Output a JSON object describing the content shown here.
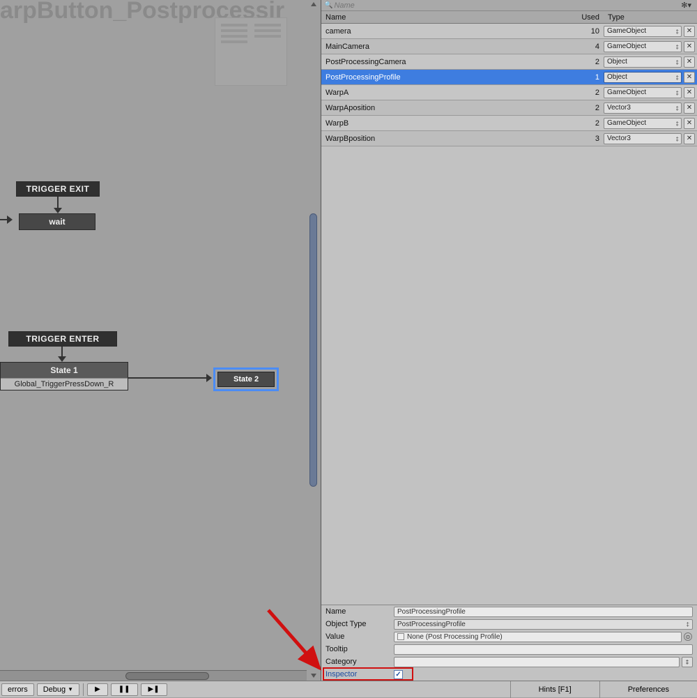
{
  "graph": {
    "title": "arpButton_Postprocessir",
    "trigger_exit": "TRIGGER EXIT",
    "wait": "wait",
    "trigger_enter": "TRIGGER ENTER",
    "state1": "State 1",
    "state1_sub": "Global_TriggerPressDown_R",
    "state2": "State 2"
  },
  "search": {
    "placeholder": "Name"
  },
  "columns": {
    "name": "Name",
    "used": "Used",
    "type": "Type"
  },
  "vars": [
    {
      "name": "camera",
      "used": 10,
      "type": "GameObject"
    },
    {
      "name": "MainCamera",
      "used": 4,
      "type": "GameObject"
    },
    {
      "name": "PostProcessingCamera",
      "used": 2,
      "type": "Object"
    },
    {
      "name": "PostProcessingProfile",
      "used": 1,
      "type": "Object",
      "selected": true
    },
    {
      "name": "WarpA",
      "used": 2,
      "type": "GameObject"
    },
    {
      "name": "WarpAposition",
      "used": 2,
      "type": "Vector3"
    },
    {
      "name": "WarpB",
      "used": 2,
      "type": "GameObject"
    },
    {
      "name": "WarpBposition",
      "used": 3,
      "type": "Vector3"
    }
  ],
  "details": {
    "name_label": "Name",
    "name_value": "PostProcessingProfile",
    "obj_type_label": "Object Type",
    "obj_type_value": "PostProcessingProfile",
    "value_label": "Value",
    "value_value": "None (Post Processing Profile)",
    "tooltip_label": "Tooltip",
    "tooltip_value": "",
    "category_label": "Category",
    "category_value": "",
    "inspector_label": "Inspector"
  },
  "bottom": {
    "errors": "errors",
    "debug": "Debug",
    "hints": "Hints [F1]",
    "prefs": "Preferences"
  }
}
